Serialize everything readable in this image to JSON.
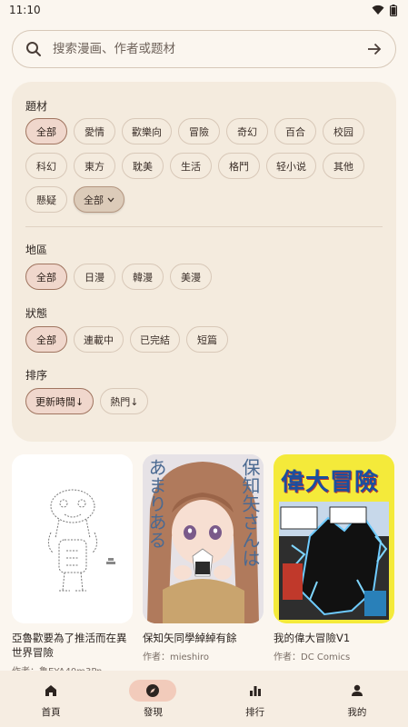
{
  "status_bar": {
    "time": "11:10"
  },
  "search": {
    "placeholder": "搜索漫画、作者或题材"
  },
  "filters": {
    "genre": {
      "title": "題材",
      "row1": [
        "全部",
        "愛情",
        "歡樂向",
        "冒險",
        "奇幻",
        "百合",
        "校园"
      ],
      "row2": [
        "科幻",
        "東方",
        "耽美",
        "生活",
        "格鬥",
        "轻小说",
        "其他"
      ],
      "row3": [
        "懸疑"
      ],
      "more_label": "全部"
    },
    "region": {
      "title": "地區",
      "options": [
        "全部",
        "日漫",
        "韓漫",
        "美漫"
      ]
    },
    "status": {
      "title": "狀態",
      "options": [
        "全部",
        "連載中",
        "已完結",
        "短篇"
      ]
    },
    "sort": {
      "title": "排序",
      "options": [
        "更新時間↓",
        "熱門↓"
      ]
    }
  },
  "comics": [
    {
      "title": "亞魯歡要為了推活而在異世界冒險",
      "author": "作者：亀EYA40m3Pn"
    },
    {
      "title": "保知矢同學綽綽有餘",
      "author": "作者：mieshiro",
      "cover_text": [
        "保知矢さんは",
        "あまりある"
      ]
    },
    {
      "title": "我的偉大冒險V1",
      "author": "作者：DC Comics",
      "cover_text": [
        "偉大冒險"
      ]
    }
  ],
  "bottom_nav": [
    {
      "label": "首頁",
      "icon": "home-icon"
    },
    {
      "label": "發現",
      "icon": "compass-icon"
    },
    {
      "label": "排行",
      "icon": "bar-chart-icon"
    },
    {
      "label": "我的",
      "icon": "person-icon"
    }
  ],
  "colors": {
    "accent": "#f2cbbb",
    "selected_border": "#a07560",
    "card_bg": "#f4ebde",
    "page_bg": "#fbf6ef"
  }
}
